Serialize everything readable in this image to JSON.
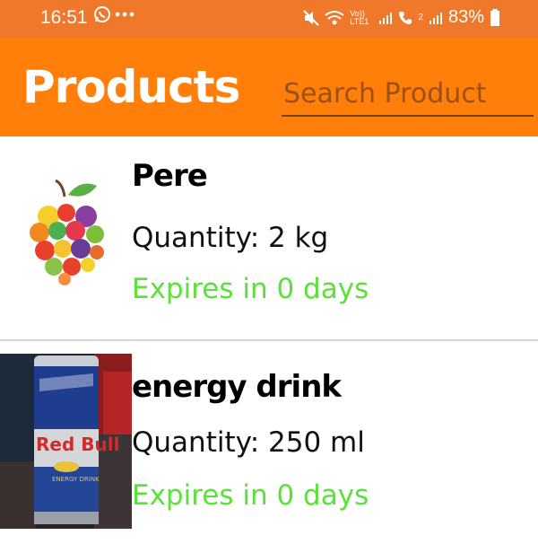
{
  "status_bar": {
    "time": "16:51",
    "left_icons": [
      "whatsapp-icon",
      "more-dots-icon"
    ],
    "right_icons": [
      "mute-icon",
      "wifi-icon",
      "volte-icon",
      "signal-1-icon",
      "call-icon",
      "signal-2-icon"
    ],
    "volte_label": "Vo)) LTE1",
    "sim2_label": "2",
    "battery": "83%"
  },
  "app_bar": {
    "title": "Products",
    "search_placeholder": "Search Product"
  },
  "products": [
    {
      "image": "fruit-apple-image",
      "name": "Pere",
      "quantity": "Quantity: 2 kg",
      "expires": "Expires in 0 days"
    },
    {
      "image": "red-bull-can-image",
      "image_text": "Red Bull",
      "image_subtext": "ENERGY DRINK",
      "name": "energy drink",
      "quantity": "Quantity: 250 ml",
      "expires": "Expires in 0 days"
    }
  ],
  "colors": {
    "status_bar": "#f0782a",
    "app_bar": "#ff7f0a",
    "expires_text": "#5ce03a",
    "search_underline": "#7a3e10"
  }
}
